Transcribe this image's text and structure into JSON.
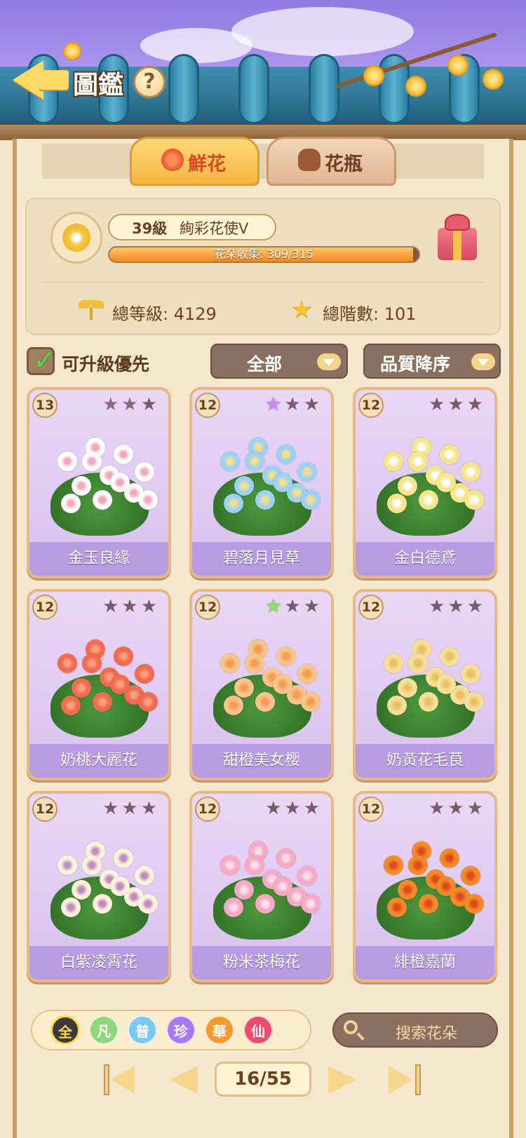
{
  "header": {
    "title": "圖鑑",
    "help_label": "?"
  },
  "tabs": [
    {
      "label": "鮮花",
      "active": true
    },
    {
      "label": "花瓶",
      "active": false
    }
  ],
  "profile": {
    "level": "39級",
    "rank_title": "絢彩花使V",
    "progress_text": "花朵收集: 309/315",
    "progress_fraction": 0.981,
    "total_level": "總等級: 4129",
    "total_tier": "總階數: 101"
  },
  "filters": {
    "upgrade_first_label": "可升級優先",
    "upgrade_first_checked": true,
    "category_selected": "全部",
    "sort_selected": "品質降序"
  },
  "cards": [
    {
      "name": "金玉良緣",
      "level": "13",
      "stars": [
        "filled",
        "filled",
        "empty"
      ],
      "flower_color": "#ffffff",
      "center_color": "#f4a6b8"
    },
    {
      "name": "碧落月見草",
      "level": "12",
      "stars": [
        "purple",
        "empty",
        "empty"
      ],
      "flower_color": "#9ed0f2",
      "center_color": "#f5e08a"
    },
    {
      "name": "金白德鳶",
      "level": "12",
      "stars": [
        "empty",
        "empty",
        "empty"
      ],
      "flower_color": "#f6e58a",
      "center_color": "#ffffff"
    },
    {
      "name": "奶桃大麗花",
      "level": "12",
      "stars": [
        "empty",
        "empty",
        "empty"
      ],
      "flower_color": "#f26a50",
      "center_color": "#f8a080"
    },
    {
      "name": "甜橙美女櫻",
      "level": "12",
      "stars": [
        "green",
        "empty",
        "empty"
      ],
      "flower_color": "#f8c48a",
      "center_color": "#f59a50"
    },
    {
      "name": "奶黃花毛茛",
      "level": "12",
      "stars": [
        "empty",
        "empty",
        "empty"
      ],
      "flower_color": "#f4de98",
      "center_color": "#e8c060"
    },
    {
      "name": "白紫凌霄花",
      "level": "12",
      "stars": [
        "empty",
        "empty",
        "empty"
      ],
      "flower_color": "#fbf1dc",
      "center_color": "#c08ac0"
    },
    {
      "name": "粉米茶梅花",
      "level": "12",
      "stars": [
        "empty",
        "empty",
        "empty"
      ],
      "flower_color": "#f6a8c4",
      "center_color": "#fbe0ea"
    },
    {
      "name": "緋橙嘉蘭",
      "level": "12",
      "stars": [
        "empty",
        "empty",
        "empty"
      ],
      "flower_color": "#f28a2a",
      "center_color": "#e04a1a"
    }
  ],
  "quality_filters": [
    {
      "label": "全",
      "color": "#ffd84a",
      "bg": "#3a3a3a",
      "selected": true
    },
    {
      "label": "凡",
      "color": "#ffffff",
      "bg": "#8ed87a",
      "selected": false
    },
    {
      "label": "普",
      "color": "#ffffff",
      "bg": "#7ac8f0",
      "selected": false
    },
    {
      "label": "珍",
      "color": "#ffffff",
      "bg": "#a57af0",
      "selected": false
    },
    {
      "label": "華",
      "color": "#ffffff",
      "bg": "#f29a2a",
      "selected": false
    },
    {
      "label": "仙",
      "color": "#ffffff",
      "bg": "#f04a6a",
      "selected": false
    }
  ],
  "search": {
    "placeholder": "搜索花朵"
  },
  "pagination": {
    "current": "16/55"
  },
  "colors": {
    "accent": "#f5b540",
    "card_bg": "#d8c0ef",
    "panel_bg": "#f4e7cd"
  }
}
